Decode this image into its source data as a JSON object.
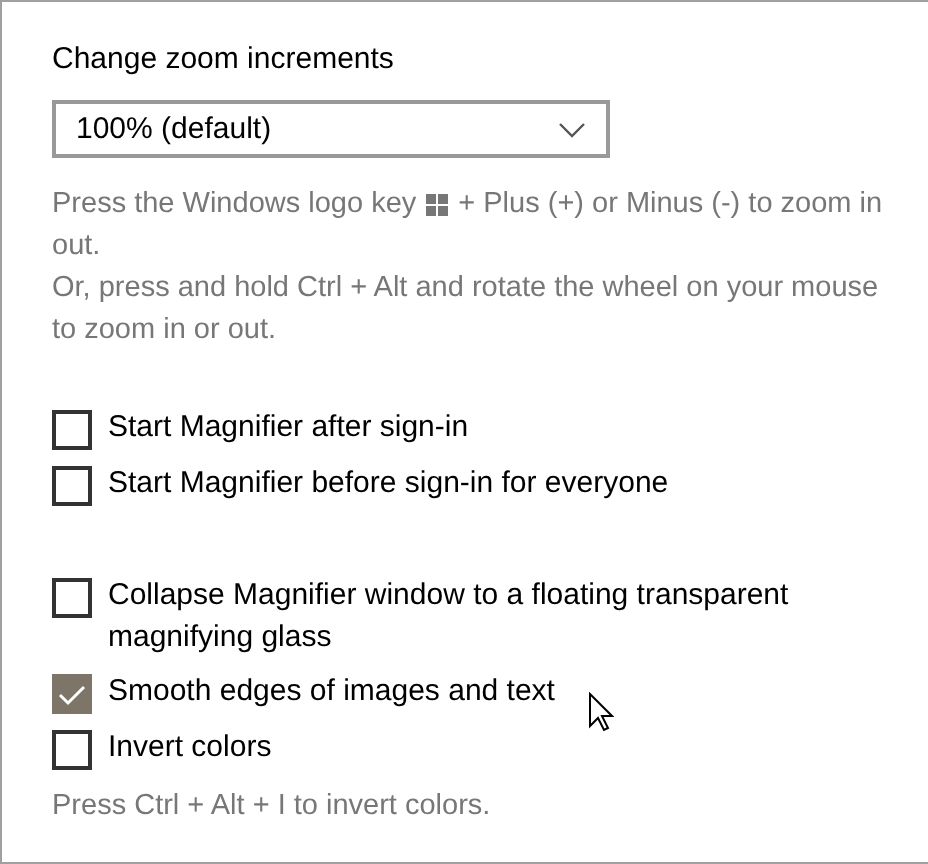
{
  "zoom_increments": {
    "label": "Change zoom increments",
    "value": "100% (default)"
  },
  "hint": {
    "before_key": "Press the Windows logo key",
    "after_key": "+ Plus (+) or Minus (-) to zoom in",
    "lines": [
      "out.",
      "Or, press and hold Ctrl + Alt and rotate the wheel on your mouse",
      "to zoom in or out."
    ]
  },
  "sign_in_options": [
    {
      "label": "Start Magnifier after sign-in",
      "checked": false
    },
    {
      "label": "Start Magnifier before sign-in for everyone",
      "checked": false
    }
  ],
  "view_options": [
    {
      "label": "Collapse Magnifier window to a floating transparent magnifying glass",
      "checked": false
    },
    {
      "label": "Smooth edges of images and text",
      "checked": true
    },
    {
      "label": "Invert colors",
      "checked": false
    }
  ],
  "invert_hint": "Press Ctrl + Alt + I to invert colors."
}
